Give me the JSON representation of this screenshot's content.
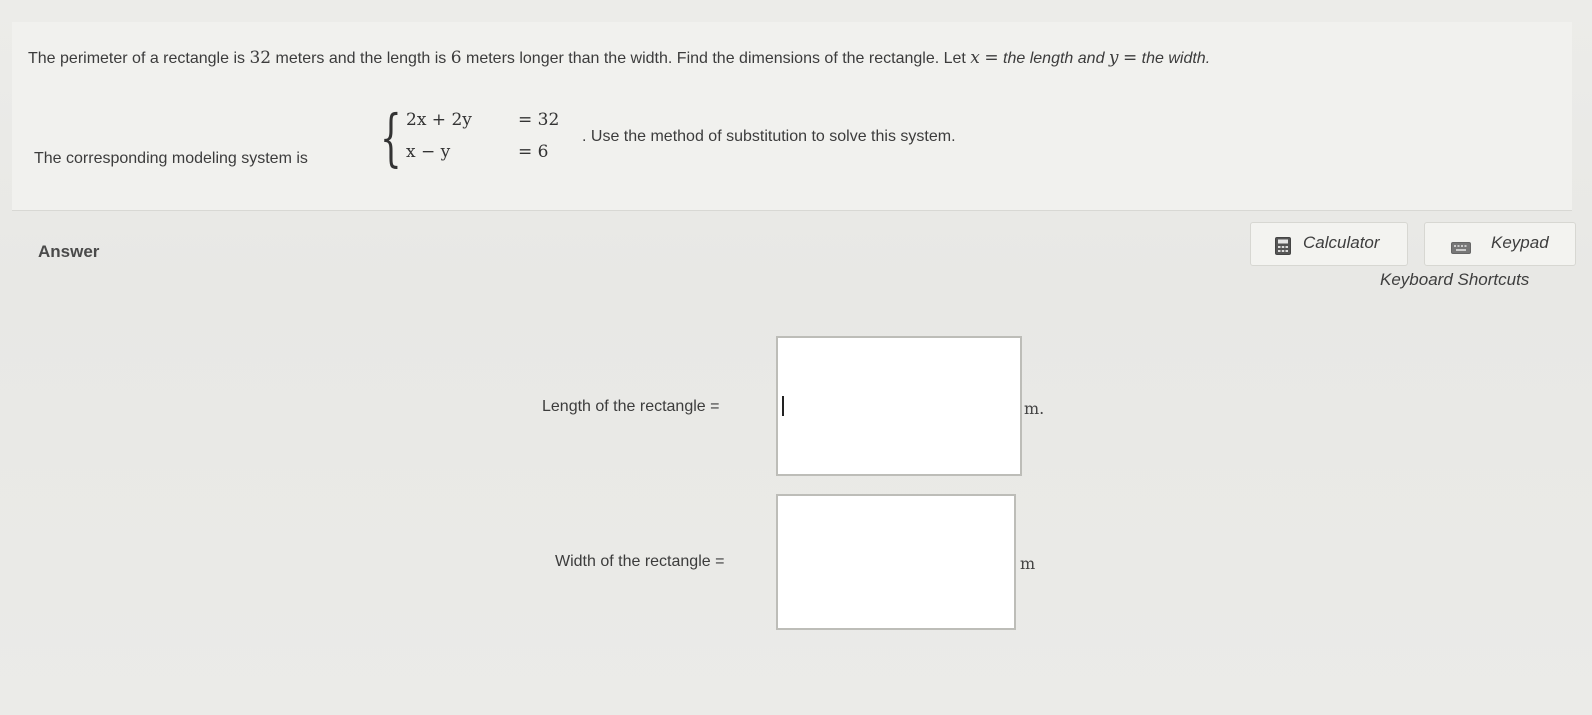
{
  "question": {
    "prompt_pre": "The perimeter of a rectangle is ",
    "perimeter": "32",
    "prompt_mid1": " meters and the length is ",
    "difference": "6",
    "prompt_mid2": " meters longer than the width. Find the dimensions of the rectangle. Let ",
    "var_x": "x",
    "equals": "=",
    "x_def": " the length and ",
    "var_y": "y",
    "y_def": " the width.",
    "system_pre": "The corresponding modeling system is",
    "eq1_lhs": "2x + 2y",
    "eq1_rhs": "= 32",
    "eq2_lhs": "x − y",
    "eq2_rhs": "= 6",
    "system_post": ". Use the method of substitution to solve this system."
  },
  "answer": {
    "label": "Answer",
    "calculator_label": "Calculator",
    "keypad_label": "Keypad",
    "shortcuts_label": "Keyboard Shortcuts",
    "length_label": "Length of the rectangle =",
    "length_value": "",
    "length_unit": "m.",
    "width_label": "Width of the rectangle =",
    "width_value": "",
    "width_unit": "m"
  },
  "icons": {
    "calculator": "calculator-icon",
    "keypad": "keyboard-icon"
  },
  "colors": {
    "background": "#e9e9e7",
    "panel": "#f1f1ee",
    "text": "#3c3c3c",
    "input_border": "#bdbdb8"
  }
}
